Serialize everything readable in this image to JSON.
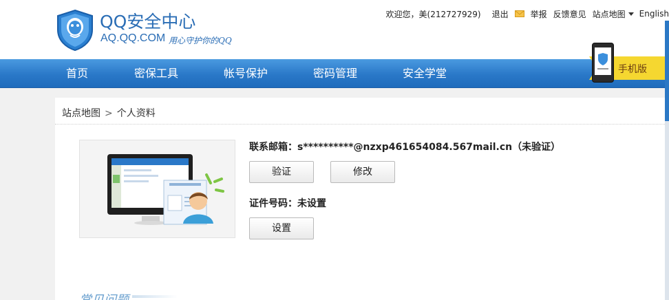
{
  "header": {
    "logo_title": "QQ安全中心",
    "logo_domain": "AQ.QQ.COM",
    "logo_slogan": "用心守护你的QQ",
    "welcome": "欢迎您，美(212727929)",
    "logout": "退出",
    "report": "举报",
    "feedback": "反馈意见",
    "sitemap": "站点地图",
    "language": "English",
    "mobile_label": "手机版"
  },
  "nav": {
    "items": [
      "首页",
      "密保工具",
      "帐号保护",
      "密码管理",
      "安全学堂"
    ]
  },
  "breadcrumb": {
    "root": "站点地图",
    "separator": ">",
    "current": "个人资料"
  },
  "profile": {
    "email_label": "联系邮箱：",
    "email_value": "s**********@nzxp461654084.567mail.cn",
    "email_status": "（未验证）",
    "verify_button": "验证",
    "modify_button": "修改",
    "id_label": "证件号码：",
    "id_value": "未设置",
    "set_button": "设置"
  },
  "faq": {
    "title": "常见问题"
  },
  "colors": {
    "brand_blue": "#2a6db5",
    "nav_blue": "#2a78c8",
    "ribbon_yellow": "#f5d730"
  }
}
